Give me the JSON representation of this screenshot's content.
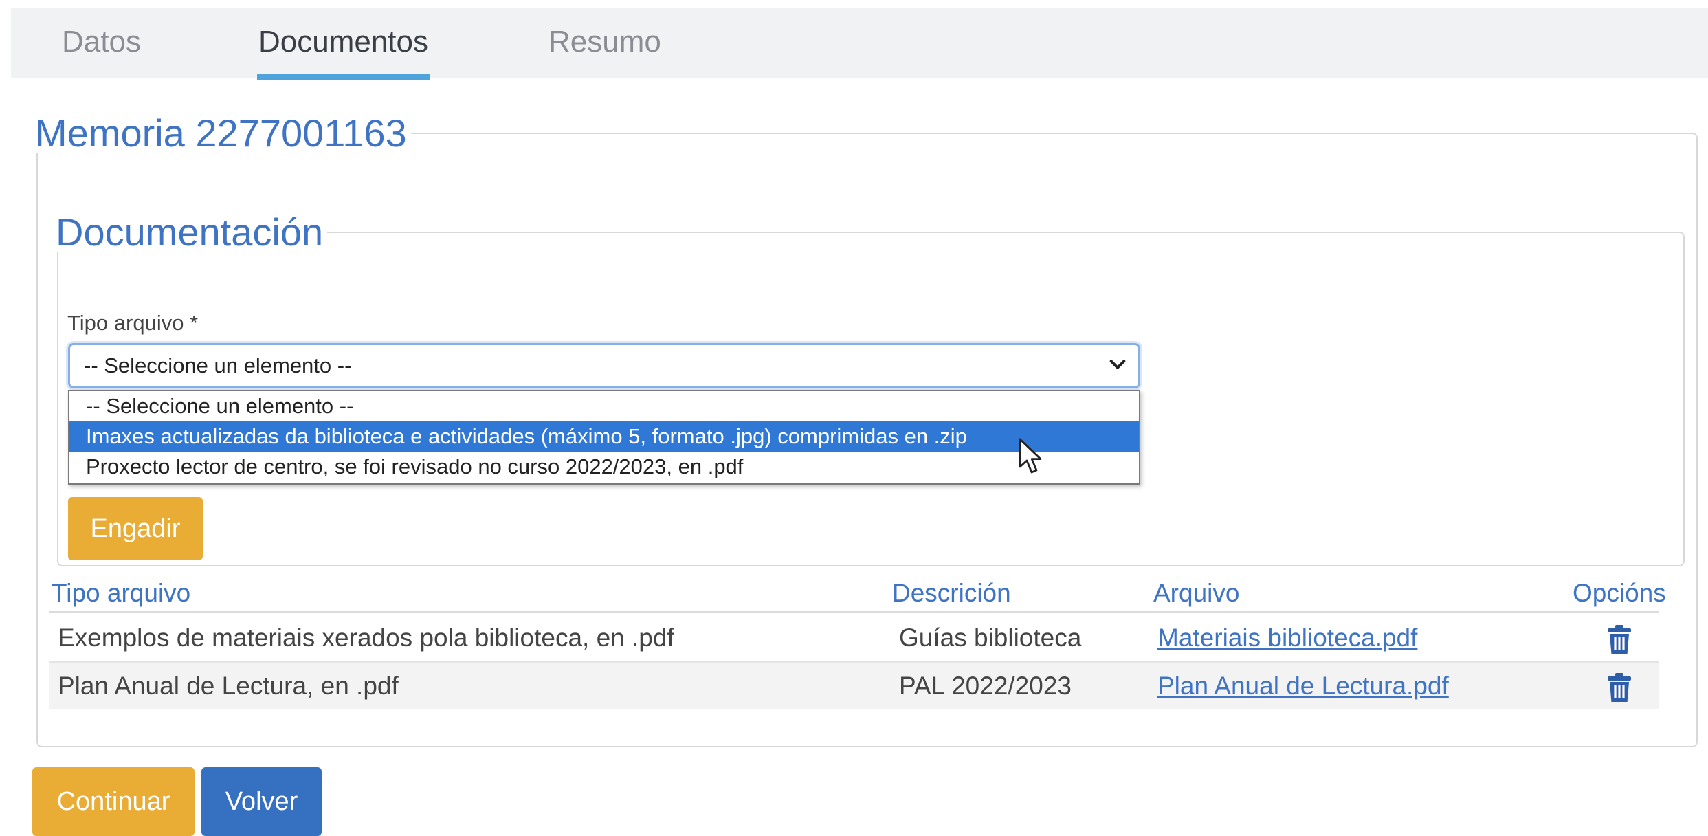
{
  "tabs": [
    {
      "label": "Datos"
    },
    {
      "label": "Documentos"
    },
    {
      "label": "Resumo"
    }
  ],
  "memoria": {
    "title": "Memoria 2277001163"
  },
  "documentacion": {
    "title": "Documentación",
    "tipo_label": "Tipo arquivo *",
    "select_value": "-- Seleccione un elemento --",
    "options": [
      {
        "label": "-- Seleccione un elemento --"
      },
      {
        "label": "Imaxes actualizadas da biblioteca e actividades (máximo 5, formato .jpg) comprimidas en .zip"
      },
      {
        "label": "Proxecto lector de centro, se foi revisado no curso 2022/2023, en .pdf"
      }
    ],
    "engadir_label": "Engadir"
  },
  "table": {
    "headers": {
      "tipo": "Tipo arquivo",
      "descricion": "Descrición",
      "arquivo": "Arquivo",
      "opcions": "Opcións"
    },
    "rows": [
      {
        "tipo": "Exemplos de materiais xerados pola biblioteca, en .pdf",
        "descricion": "Guías biblioteca",
        "arquivo": "Materiais biblioteca.pdf"
      },
      {
        "tipo": "Plan Anual de Lectura, en .pdf",
        "descricion": "PAL 2022/2023",
        "arquivo": "Plan Anual de Lectura.pdf"
      }
    ]
  },
  "footer": {
    "continuar_label": "Continuar",
    "volver_label": "Volver"
  },
  "colors": {
    "accent_blue": "#3f74c4",
    "tab_underline": "#4fa3dd",
    "warning_button": "#e9ac35",
    "primary_button": "#3571c0",
    "highlight_option": "#2f78d6"
  },
  "icons": {
    "select_chevron": "chevron-down-icon",
    "delete": "trash-icon",
    "pointer": "mouse-cursor-icon"
  }
}
